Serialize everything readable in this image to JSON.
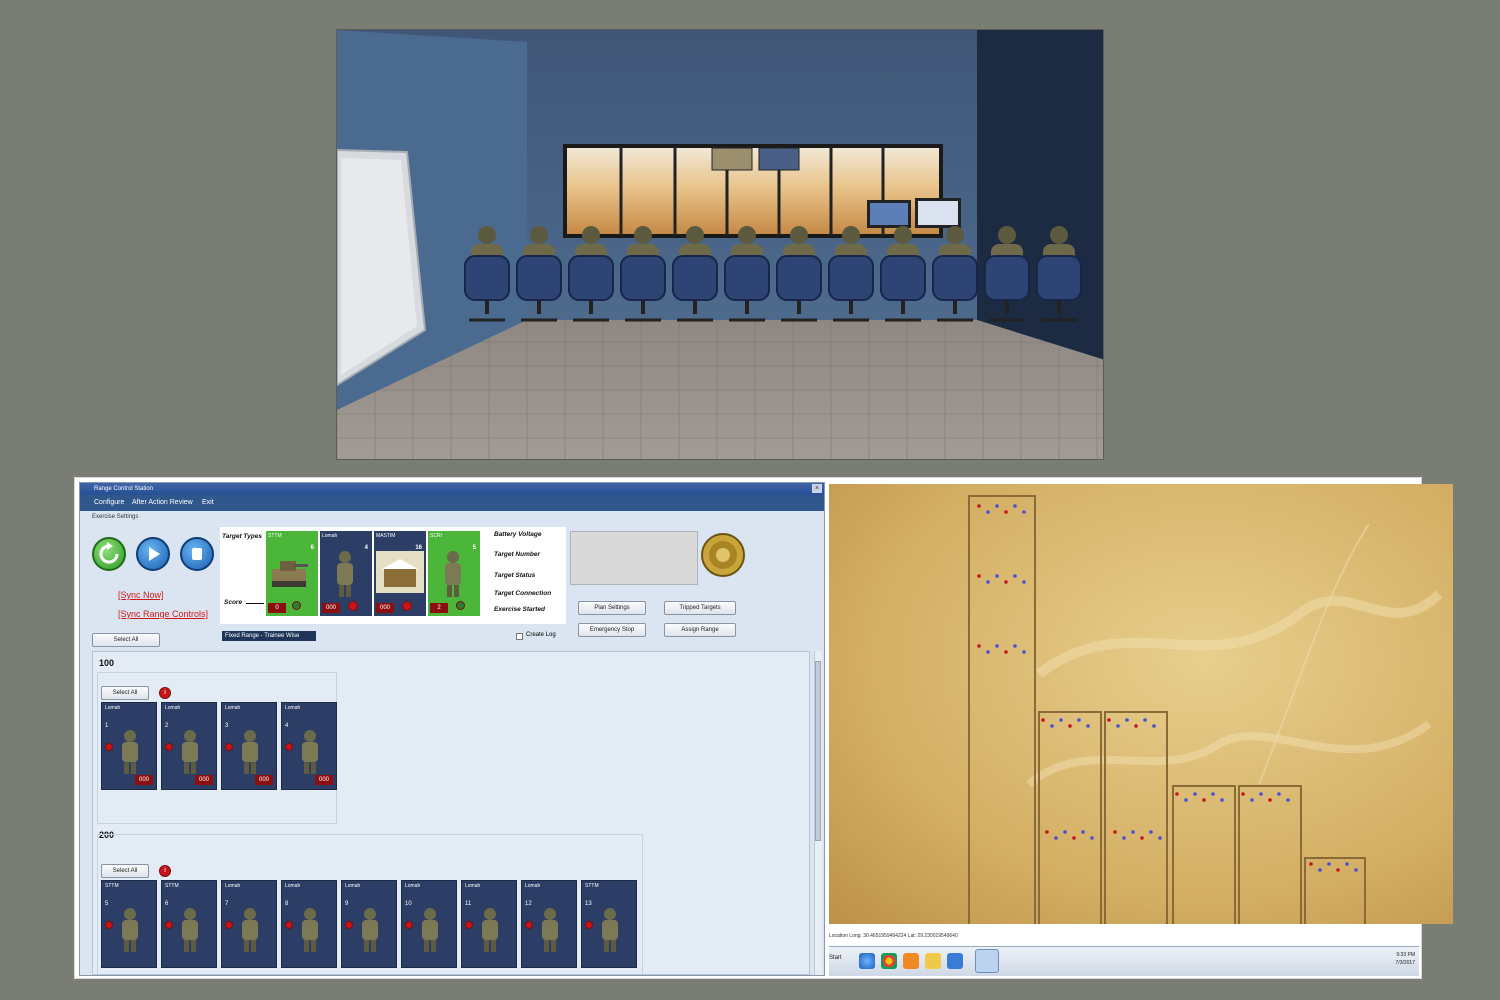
{
  "window_title": "Range Control Station",
  "menu": [
    "Configure",
    "After Action Review",
    "Exit"
  ],
  "exercise_settings_label": "Exercise Settings",
  "sync_now": "[Sync Now]",
  "sync_range_controls": "[Sync Range Controls]",
  "select_all": "Select All",
  "target_types_label": "Target Types",
  "score_label": "Score",
  "target_types": [
    {
      "name": "STTM",
      "number": "6",
      "score": "0",
      "color": "#4bb63a"
    },
    {
      "name": "Lomah",
      "number": "4",
      "score": "000",
      "color": "#2c3e66"
    },
    {
      "name": "MASTIM",
      "number": "16",
      "score": "000",
      "color": "#2c3e66"
    },
    {
      "name": "SCRI",
      "number": "5",
      "score": "2",
      "color": "#4bb63a"
    }
  ],
  "legend_labels": [
    "Battery Voltage",
    "Target Number",
    "Target Status",
    "Target Connection",
    "Exercise Started"
  ],
  "buttons": {
    "plan_settings": "Plan Settings",
    "tripped_targets": "Tripped Targets",
    "emergency_stop": "Emergency Stop",
    "assign_range": "Assign Range",
    "create_log": "Create Log"
  },
  "range_select": "Fixed Range - Trainee Wise",
  "lanes": [
    {
      "label": "100",
      "select_all": "Select All",
      "targets": [
        {
          "type": "Lomah",
          "number": "1",
          "score": "000"
        },
        {
          "type": "Lomah",
          "number": "2",
          "score": "000"
        },
        {
          "type": "Lomah",
          "number": "3",
          "score": "000"
        },
        {
          "type": "Lomah",
          "number": "4",
          "score": "000"
        }
      ]
    },
    {
      "label": "200",
      "select_all": "Select All",
      "targets": [
        {
          "type": "STTM",
          "number": "5"
        },
        {
          "type": "STTM",
          "number": "6"
        },
        {
          "type": "Lomah",
          "number": "7"
        },
        {
          "type": "Lomah",
          "number": "8"
        },
        {
          "type": "Lomah",
          "number": "9"
        },
        {
          "type": "Lomah",
          "number": "10"
        },
        {
          "type": "Lomah",
          "number": "11"
        },
        {
          "type": "Lomah",
          "number": "12"
        },
        {
          "type": "STTM",
          "number": "13"
        }
      ]
    }
  ],
  "map_status": "Location Long: 30.4651959494224   Lat: 29.230019549640",
  "taskbar": {
    "start": "Start",
    "time": "9:33 PM",
    "date": "7/3/2017",
    "icons": [
      "ie-icon",
      "chrome-icon",
      "media-icon",
      "folder-icon",
      "app-icon",
      "active-app-icon"
    ]
  }
}
